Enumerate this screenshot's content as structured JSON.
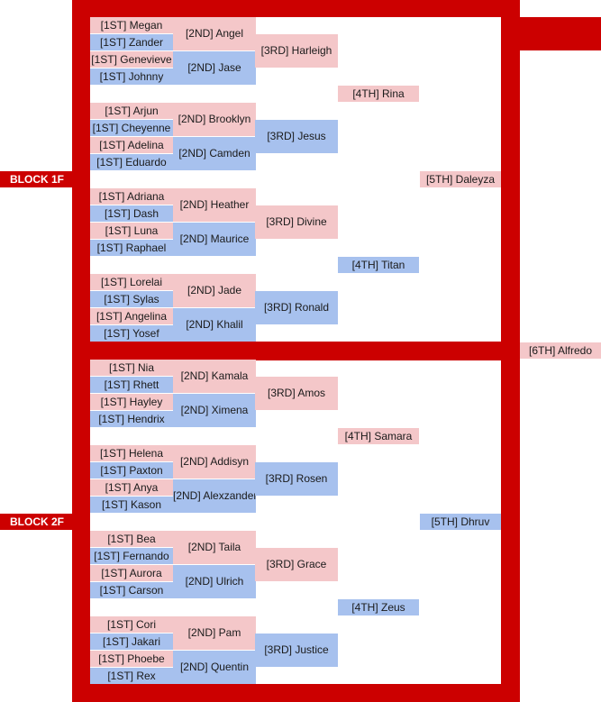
{
  "blocks": [
    {
      "label": "BLOCK 1F",
      "first": [
        "[1ST] Megan",
        "[1ST] Zander",
        "[1ST] Genevieve",
        "[1ST] Johnny",
        "[1ST] Arjun",
        "[1ST] Cheyenne",
        "[1ST] Adelina",
        "[1ST] Eduardo",
        "[1ST] Adriana",
        "[1ST] Dash",
        "[1ST] Luna",
        "[1ST] Raphael",
        "[1ST] Lorelai",
        "[1ST] Sylas",
        "[1ST] Angelina",
        "[1ST] Yosef"
      ],
      "second": [
        "[2ND] Angel",
        "[2ND] Jase",
        "[2ND] Brooklyn",
        "[2ND] Camden",
        "[2ND] Heather",
        "[2ND] Maurice",
        "[2ND] Jade",
        "[2ND] Khalil"
      ],
      "third": [
        "[3RD] Harleigh",
        "[3RD] Jesus",
        "[3RD] Divine",
        "[3RD] Ronald"
      ],
      "fourth": [
        "[4TH] Rina",
        "[4TH] Titan"
      ],
      "fifth": "[5TH] Daleyza"
    },
    {
      "label": "BLOCK 2F",
      "first": [
        "[1ST] Nia",
        "[1ST] Rhett",
        "[1ST] Hayley",
        "[1ST] Hendrix",
        "[1ST] Helena",
        "[1ST] Paxton",
        "[1ST] Anya",
        "[1ST] Kason",
        "[1ST] Bea",
        "[1ST] Fernando",
        "[1ST] Aurora",
        "[1ST] Carson",
        "[1ST] Cori",
        "[1ST] Jakari",
        "[1ST] Phoebe",
        "[1ST] Rex"
      ],
      "second": [
        "[2ND] Kamala",
        "[2ND] Ximena",
        "[2ND] Addisyn",
        "[2ND] Alexzander",
        "[2ND] Taila",
        "[2ND] Ulrich",
        "[2ND] Pam",
        "[2ND] Quentin"
      ],
      "third": [
        "[3RD] Amos",
        "[3RD] Rosen",
        "[3RD] Grace",
        "[3RD] Justice"
      ],
      "fourth": [
        "[4TH] Samara",
        "[4TH] Zeus"
      ],
      "fifth": "[5TH] Dhruv"
    }
  ],
  "sixth": "[6TH] Alfredo",
  "colors": {
    "frame": "#cc0000",
    "upper": "#f4c7c9",
    "lower": "#a7c1ee"
  }
}
